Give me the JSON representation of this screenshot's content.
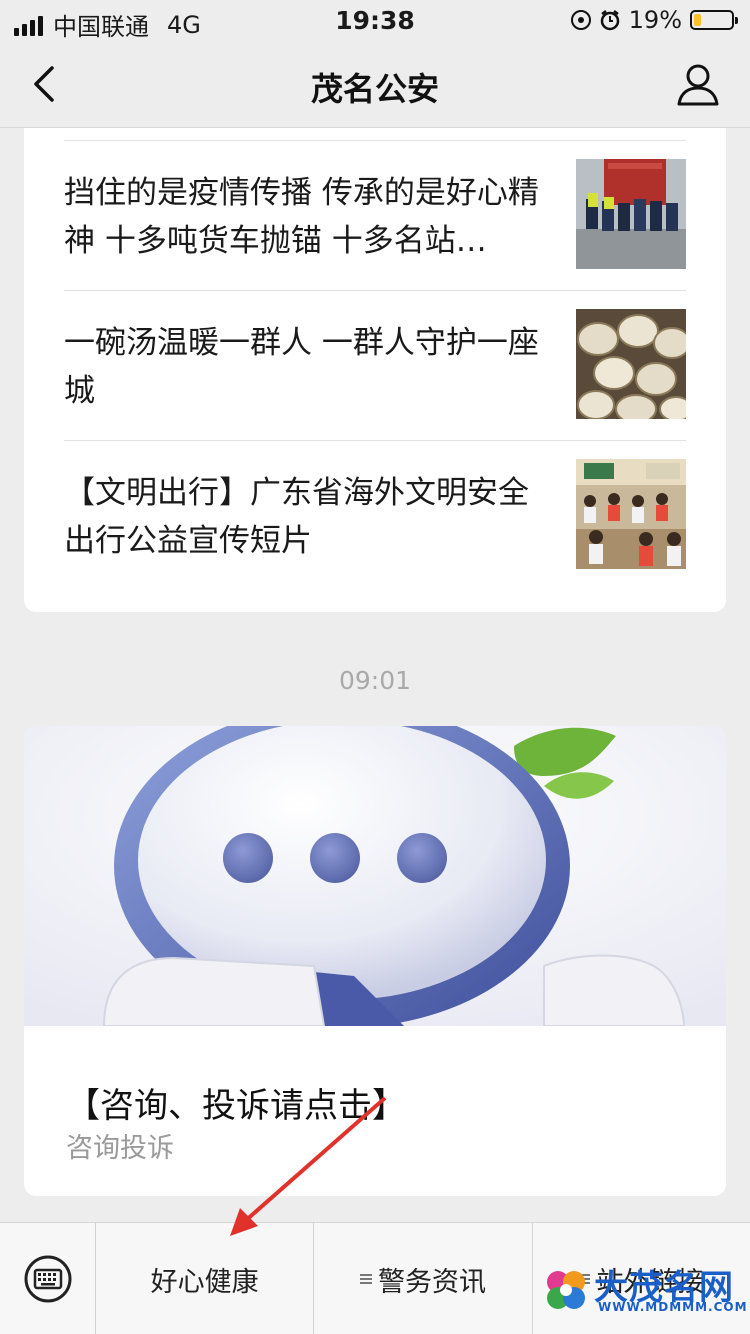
{
  "status_bar": {
    "carrier": "中国联通",
    "network": "4G",
    "time": "19:38",
    "battery": "19%",
    "battery_level": 0.19
  },
  "nav": {
    "title": "茂名公安",
    "back_icon": "chevron-left-icon",
    "profile_icon": "person-icon"
  },
  "news": [
    {
      "title": "挡住的是疫情传播 传承的是好心精神 十多吨货车抛锚 十多名站…",
      "thumb": "police-pushing-truck"
    },
    {
      "title": "一碗汤温暖一群人  一群人守护一座城",
      "thumb": "soup-bowls"
    },
    {
      "title": "【文明出行】广东省海外文明安全出行公益宣传短片",
      "thumb": "classroom-students"
    }
  ],
  "timestamp": "09:01",
  "feature": {
    "headline": "【咨询、投诉请点击】",
    "digest": "咨询投诉"
  },
  "menu": {
    "keyboard_icon": "keyboard-icon",
    "items": [
      "好心健康",
      "警务资讯",
      "站外链接"
    ]
  },
  "watermark": {
    "text": "大茂名网",
    "url": "WWW.MDMMM.COM"
  },
  "colors": {
    "background": "#ededed",
    "accent_arrow": "#e0312b",
    "battery": "#f7c22a",
    "watermark": "#1a5fc8"
  }
}
